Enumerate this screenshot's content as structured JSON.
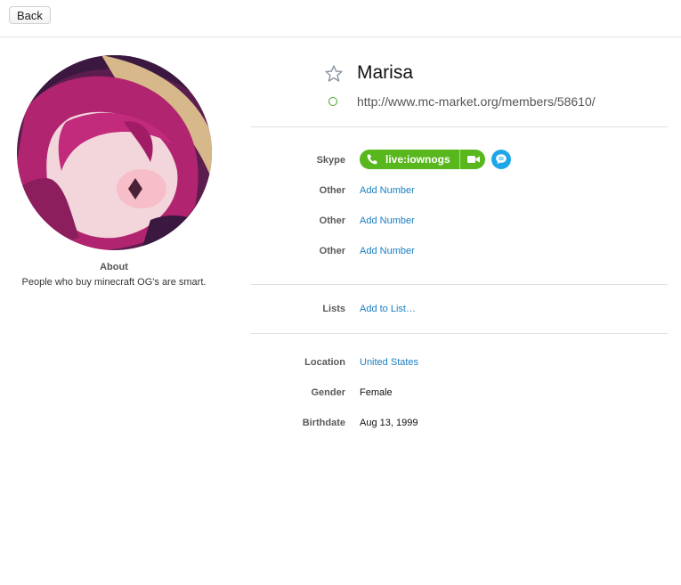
{
  "header": {
    "back_label": "Back"
  },
  "profile": {
    "name": "Marisa",
    "url": "http://www.mc-market.org/members/58610/",
    "about_title": "About",
    "about_text": "People who buy minecraft OG's are smart."
  },
  "contact": {
    "skype_label": "Skype",
    "skype_handle": "live:iownogs",
    "others": [
      {
        "label": "Other",
        "value": "Add Number"
      },
      {
        "label": "Other",
        "value": "Add Number"
      },
      {
        "label": "Other",
        "value": "Add Number"
      }
    ]
  },
  "lists": {
    "label": "Lists",
    "value": "Add to List…"
  },
  "details": {
    "location_label": "Location",
    "location_value": "United States",
    "gender_label": "Gender",
    "gender_value": "Female",
    "birthdate_label": "Birthdate",
    "birthdate_value": "Aug 13, 1999"
  },
  "colors": {
    "accent_link": "#1b7fc1",
    "skype_green": "#58b71c",
    "chat_blue": "#1ea7e8",
    "status_green": "#4aa32d"
  },
  "icons": [
    "star-icon",
    "status-circle-icon",
    "phone-icon",
    "video-icon",
    "chat-icon"
  ]
}
